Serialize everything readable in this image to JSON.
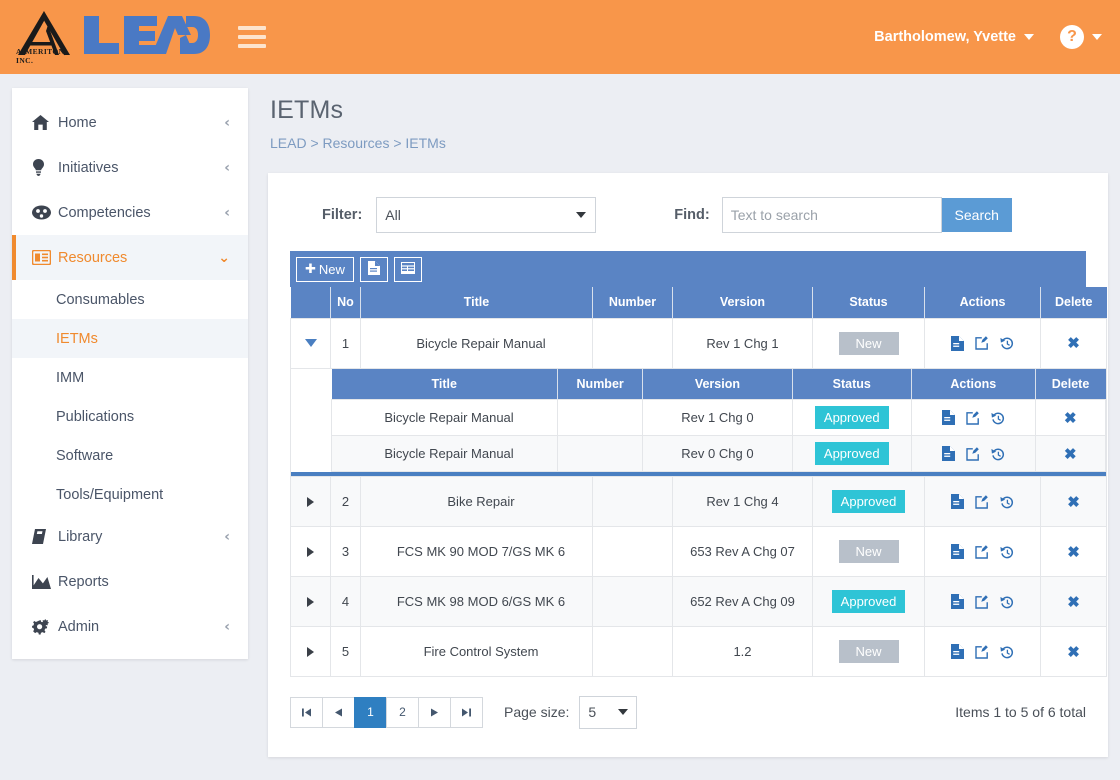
{
  "header": {
    "brand_word": "LEAD",
    "brand_sub": "AIMERITON, INC.",
    "menu_icon": "hamburger-icon",
    "user_name": "Bartholomew, Yvette",
    "help_glyph": "?"
  },
  "sidebar": {
    "items": [
      {
        "label": "Home",
        "icon": "home-icon",
        "chevron": "‹",
        "active": false
      },
      {
        "label": "Initiatives",
        "icon": "lightbulb-icon",
        "chevron": "‹",
        "active": false
      },
      {
        "label": "Competencies",
        "icon": "competencies-icon",
        "chevron": "‹",
        "active": false
      },
      {
        "label": "Resources",
        "icon": "resources-icon",
        "chevron": "⌄",
        "active": true
      }
    ],
    "subitems": [
      {
        "label": "Consumables",
        "active": false
      },
      {
        "label": "IETMs",
        "active": true
      },
      {
        "label": "IMM",
        "active": false
      },
      {
        "label": "Publications",
        "active": false
      },
      {
        "label": "Software",
        "active": false
      },
      {
        "label": "Tools/Equipment",
        "active": false
      }
    ],
    "items_bottom": [
      {
        "label": "Library",
        "icon": "book-icon",
        "chevron": "‹",
        "active": false
      },
      {
        "label": "Reports",
        "icon": "chart-icon",
        "chevron": "",
        "active": false
      },
      {
        "label": "Admin",
        "icon": "gears-icon",
        "chevron": "‹",
        "active": false
      }
    ]
  },
  "page": {
    "title": "IETMs",
    "breadcrumb": "LEAD > Resources > IETMs"
  },
  "filter": {
    "filter_label": "Filter:",
    "filter_value": "All",
    "find_label": "Find:",
    "find_value": "",
    "find_placeholder": "Text to search",
    "search_button": "Search"
  },
  "toolbar": {
    "new_label": "New",
    "new_plus": "✚",
    "doc_button_icon": "document-icon",
    "grid_button_icon": "grid-view-icon"
  },
  "grid": {
    "columns": [
      "",
      "No",
      "Title",
      "Number",
      "Version",
      "Status",
      "Actions",
      "Delete"
    ],
    "sub_columns": [
      "Title",
      "Number",
      "Version",
      "Status",
      "Actions",
      "Delete"
    ],
    "action_icons": [
      "view-document-icon",
      "edit-icon",
      "history-icon"
    ],
    "delete_icon": "✖",
    "rows": [
      {
        "expanded": true,
        "no": "1",
        "title": "Bicycle Repair Manual",
        "number": "",
        "version": "Rev 1 Chg 1",
        "status": "New",
        "status_type": "new",
        "children": [
          {
            "title": "Bicycle Repair Manual",
            "number": "",
            "version": "Rev 1 Chg 0",
            "status": "Approved",
            "status_type": "approved"
          },
          {
            "title": "Bicycle Repair Manual",
            "number": "",
            "version": "Rev 0 Chg 0",
            "status": "Approved",
            "status_type": "approved"
          }
        ]
      },
      {
        "expanded": false,
        "no": "2",
        "title": "Bike Repair",
        "number": "",
        "version": "Rev 1 Chg 4",
        "status": "Approved",
        "status_type": "approved",
        "children": []
      },
      {
        "expanded": false,
        "no": "3",
        "title": "FCS MK 90 MOD 7/GS MK 6",
        "number": "",
        "version": "653 Rev A Chg 07",
        "status": "New",
        "status_type": "new",
        "children": []
      },
      {
        "expanded": false,
        "no": "4",
        "title": "FCS MK 98 MOD 6/GS MK 6",
        "number": "",
        "version": "652 Rev A Chg 09",
        "status": "Approved",
        "status_type": "approved",
        "children": []
      },
      {
        "expanded": false,
        "no": "5",
        "title": "Fire Control System",
        "number": "",
        "version": "1.2",
        "status": "New",
        "status_type": "new",
        "children": []
      }
    ]
  },
  "pager": {
    "first": "⏮",
    "prev": "◀",
    "pages": [
      "1",
      "2"
    ],
    "active_page": "1",
    "next": "▶",
    "last": "⏭",
    "page_size_label": "Page size:",
    "page_size_value": "5",
    "items_info": "Items 1 to 5 of 6 total"
  },
  "colors": {
    "brand_orange": "#f8964a",
    "accent_blue": "#5a84c4",
    "approved_teal": "#2ec4d6",
    "new_gray": "#b8c0ca",
    "active_page_blue": "#2f7fc1"
  }
}
